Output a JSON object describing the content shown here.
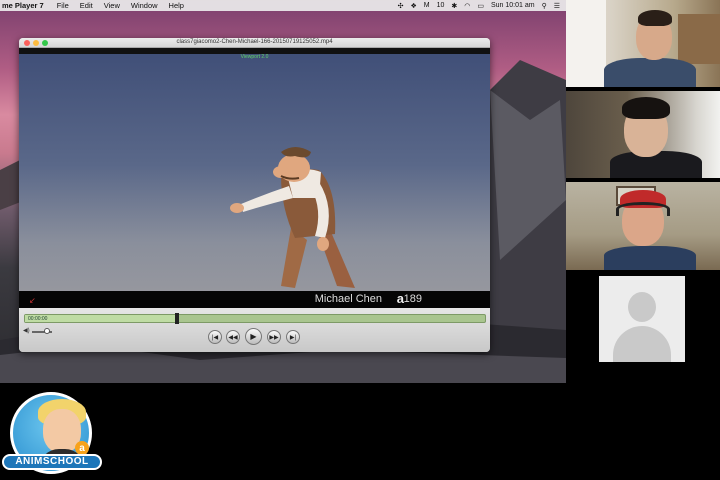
{
  "menubar": {
    "app_name": "me Player 7",
    "items": [
      "File",
      "Edit",
      "View",
      "Window",
      "Help"
    ],
    "status": {
      "mail_count": "10",
      "clock": "Sun 10:01 am"
    }
  },
  "player": {
    "window_title": "class7giacomo2-Chen-Michael-166-20150719125052.mp4",
    "viewport_label": "Viewport 2.0",
    "overlay": {
      "student_name": "Michael Chen",
      "logo_glyph": "a",
      "frame_number": "189"
    },
    "timecode": "00:00:00",
    "progress_fraction": 0.33,
    "volume_fraction": 0.75
  },
  "school": {
    "name": "ANIMSCHOOL",
    "badge_glyph": "a"
  },
  "colors": {
    "accent_blue": "#1d76b9",
    "timeline_green": "#a9c58f",
    "close_red": "#fc605b",
    "minimize_yellow": "#fdbc40",
    "zoom_green": "#34c84a"
  }
}
